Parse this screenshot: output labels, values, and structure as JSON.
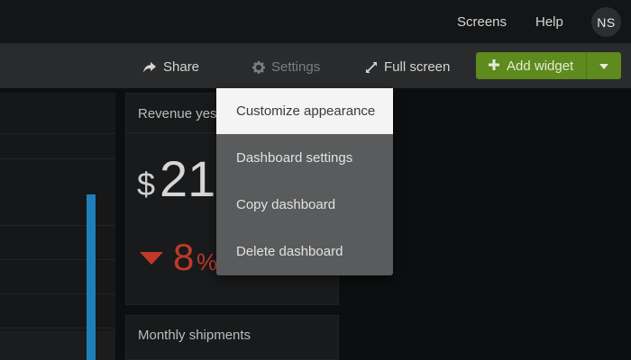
{
  "topnav": {
    "links": [
      "Screens",
      "Help"
    ],
    "avatar_initials": "NS"
  },
  "toolbar": {
    "share_label": "Share",
    "share_icon": "share-arrow-icon",
    "settings_label": "Settings",
    "settings_icon": "gear-icon",
    "fullscreen_label": "Full screen",
    "fullscreen_icon": "expand-arrows-icon",
    "add_widget_label": "Add widget",
    "add_widget_icon": "plus-icon",
    "add_widget_color": "#5f8a1d"
  },
  "widgets": {
    "revenue": {
      "title": "Revenue yest",
      "currency": "$",
      "amount": "21",
      "change": "8",
      "change_unit": "%",
      "change_direction": "down",
      "negative_color": "#c0392b"
    },
    "shipments": {
      "title": "Monthly shipments"
    },
    "bar_color": "#1f7fb8"
  },
  "settings_menu": {
    "items": [
      {
        "label": "Customize appearance",
        "highlighted": true
      },
      {
        "label": "Dashboard settings",
        "highlighted": false
      },
      {
        "label": "Copy dashboard",
        "highlighted": false
      },
      {
        "label": "Delete dashboard",
        "highlighted": false
      }
    ]
  }
}
